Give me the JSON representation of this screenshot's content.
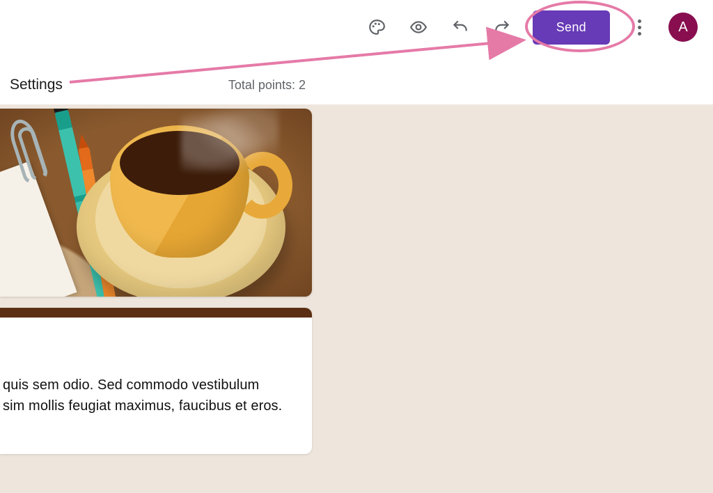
{
  "toolbar": {
    "send_label": "Send"
  },
  "avatar": {
    "initial": "A"
  },
  "subbar": {
    "settings_label": "Settings",
    "points_label": "Total points: 2"
  },
  "card": {
    "body": " quis sem odio. Sed commodo vestibulum\nsim mollis feugiat maximus, faucibus et eros."
  },
  "icons": {
    "palette": "palette-icon",
    "eye": "eye-icon",
    "undo": "undo-icon",
    "redo": "redo-icon",
    "more": "more-icon"
  },
  "colors": {
    "brand": "#673ab7",
    "annotation": "#e57aa7",
    "avatar_bg": "#880e4f",
    "canvas_bg": "#eee6dd",
    "card_bar": "#5b2f13"
  }
}
